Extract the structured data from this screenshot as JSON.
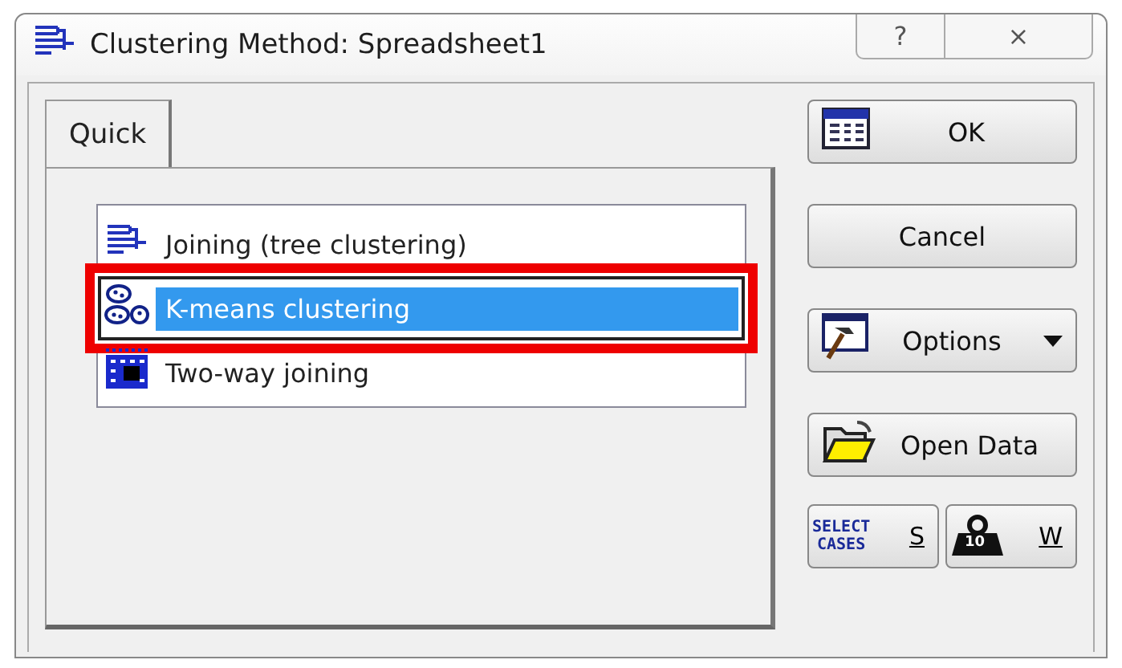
{
  "window": {
    "title": "Clustering Method: Spreadsheet1",
    "buttons": [
      "?",
      "×"
    ]
  },
  "tabs": [
    {
      "label": "Quick",
      "selected": true
    }
  ],
  "methods": [
    {
      "label": "Joining (tree clustering)",
      "kind": "tree",
      "selected": false,
      "highlighted": false
    },
    {
      "label": "K-means clustering",
      "kind": "kmeans",
      "selected": true,
      "highlighted": true
    },
    {
      "label": "Two-way joining",
      "kind": "grid",
      "selected": false,
      "highlighted": false
    }
  ],
  "buttons": [
    {
      "label": "OK",
      "kind": "table",
      "dropdown": false
    },
    {
      "label": "Cancel",
      "kind": "plain",
      "dropdown": false
    },
    {
      "label": "Options",
      "kind": "hammer",
      "dropdown": true
    },
    {
      "label": "Open Data",
      "kind": "folder",
      "dropdown": false
    }
  ],
  "small_buttons": [
    {
      "kind": "select",
      "caption": [
        "SELECT",
        "CASES"
      ],
      "key": "S"
    },
    {
      "kind": "weight",
      "caption": [
        "10"
      ],
      "key": "W"
    }
  ]
}
